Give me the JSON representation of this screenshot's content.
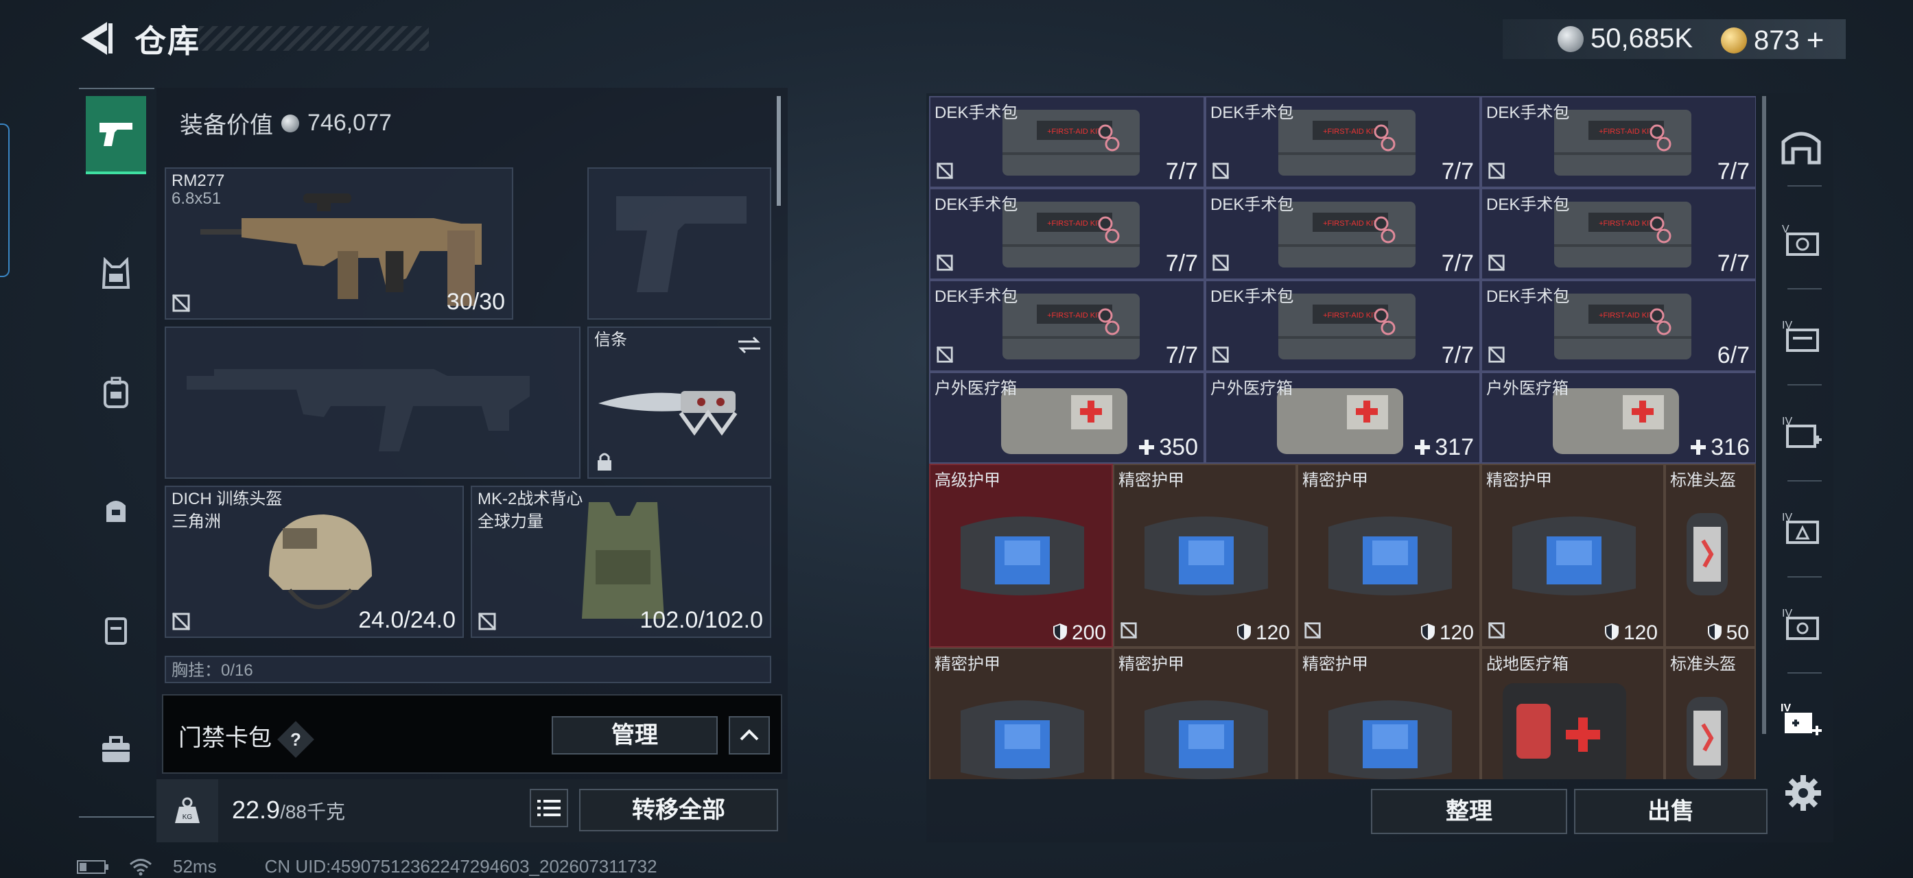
{
  "header": {
    "title": "仓库"
  },
  "currency": [
    {
      "icon": "silver-coin-icon",
      "value": "50,685K"
    },
    {
      "icon": "gold-coin-icon",
      "value": "873",
      "action": "+"
    }
  ],
  "left_nav": [
    "pistol-icon",
    "chest-rig-icon",
    "backpack-icon",
    "pouch-icon",
    "case-icon",
    "toolbox-icon"
  ],
  "equipment": {
    "value_label": "装备价值",
    "value": "746,077",
    "primary": {
      "name": "RM277",
      "caliber": "6.8x51",
      "ammo": "30/30"
    },
    "melee": {
      "name": "信条"
    },
    "helmet": {
      "name": "DICH 训练头盔",
      "source": "三角洲",
      "durability": "24.0/24.0"
    },
    "armor": {
      "name": "MK-2战术背心",
      "source": "全球力量",
      "durability": "102.0/102.0"
    },
    "chest_rig": {
      "label": "胸挂：0/16"
    }
  },
  "card_bag": {
    "label": "门禁卡包",
    "help": "?",
    "manage": "管理"
  },
  "weight": {
    "current": "22.9",
    "max": "/88千克"
  },
  "transfer_all": "转移全部",
  "status": {
    "ping": "52ms",
    "uid": "CN UID:459075123622472946​03_202607311732"
  },
  "inventory": {
    "rows": [
      [
        {
          "name": "DEK手术包",
          "count": "7/7",
          "type": "kit"
        },
        {
          "name": "DEK手术包",
          "count": "7/7",
          "type": "kit"
        },
        {
          "name": "DEK手术包",
          "count": "7/7",
          "type": "kit"
        }
      ],
      [
        {
          "name": "DEK手术包",
          "count": "7/7",
          "type": "kit"
        },
        {
          "name": "DEK手术包",
          "count": "7/7",
          "type": "kit"
        },
        {
          "name": "DEK手术包",
          "count": "7/7",
          "type": "kit"
        }
      ],
      [
        {
          "name": "DEK手术包",
          "count": "7/7",
          "type": "kit"
        },
        {
          "name": "DEK手术包",
          "count": "7/7",
          "type": "kit"
        },
        {
          "name": "DEK手术包",
          "count": "6/7",
          "type": "kit"
        }
      ],
      [
        {
          "name": "户外医疗箱",
          "count": "350",
          "type": "med"
        },
        {
          "name": "户外医疗箱",
          "count": "317",
          "type": "med"
        },
        {
          "name": "户外医疗箱",
          "count": "316",
          "type": "med"
        }
      ]
    ],
    "armor_row1": [
      {
        "name": "高级护甲",
        "count": "200",
        "rarity": "red"
      },
      {
        "name": "精密护甲",
        "count": "120",
        "rarity": "brown"
      },
      {
        "name": "精密护甲",
        "count": "120",
        "rarity": "brown"
      },
      {
        "name": "精密护甲",
        "count": "120",
        "rarity": "brown"
      },
      {
        "name": "标准头盔",
        "count": "50",
        "rarity": "brown"
      }
    ],
    "armor_row2": [
      {
        "name": "精密护甲",
        "rarity": "brown"
      },
      {
        "name": "精密护甲",
        "rarity": "brown"
      },
      {
        "name": "精密护甲",
        "rarity": "brown"
      },
      {
        "name": "战地医疗箱",
        "rarity": "brown"
      },
      {
        "name": "标准头盔",
        "rarity": "brown"
      }
    ]
  },
  "actions": {
    "sort": "整理",
    "sell": "出售"
  },
  "right_nav": [
    "storage-icon",
    "case-v-icon",
    "case-iv-icon",
    "medkit-iv-icon",
    "triangle-iv-icon",
    "case-iv-2-icon",
    "medkit-iv-add-icon"
  ],
  "colors": {
    "accent": "#1f7a5a",
    "rarity_red": "#5a1b22",
    "rarity_brown": "#3a2d27",
    "rarity_purple": "#262a44"
  }
}
